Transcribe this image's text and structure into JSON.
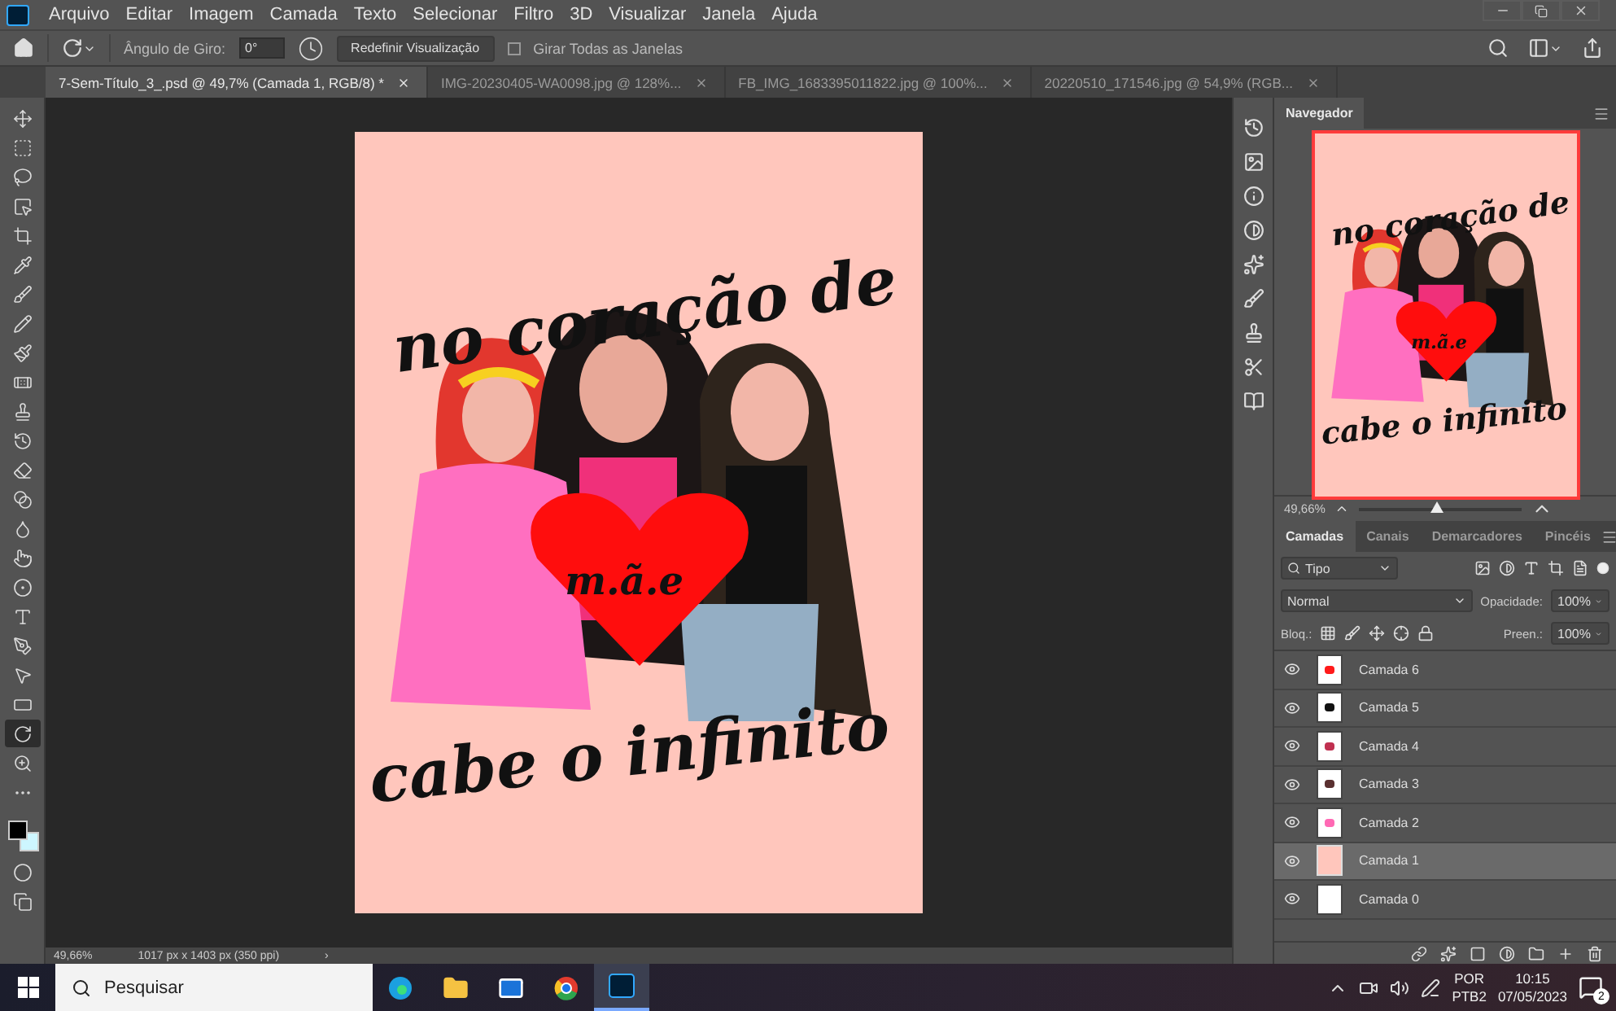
{
  "menu_bar": {
    "items": [
      "Arquivo",
      "Editar",
      "Imagem",
      "Camada",
      "Texto",
      "Selecionar",
      "Filtro",
      "3D",
      "Visualizar",
      "Janela",
      "Ajuda"
    ]
  },
  "options_bar": {
    "angle_label": "Ângulo de Giro:",
    "angle_value": "0°",
    "reset_button": "Redefinir Visualização",
    "rotate_all": {
      "label": "Girar Todas as Janelas",
      "checked": false
    }
  },
  "document_tabs": [
    {
      "label": "7-Sem-Título_3_.psd @ 49,7% (Camada 1, RGB/8) *",
      "selected": true
    },
    {
      "label": "IMG-20230405-WA0098.jpg @ 128%...",
      "selected": false
    },
    {
      "label": "FB_IMG_1683395011822.jpg @ 100%...",
      "selected": false
    },
    {
      "label": "20220510_171546.jpg @ 54,9% (RGB...",
      "selected": false
    }
  ],
  "tools": [
    {
      "selected": false
    },
    {
      "selected": false
    },
    {
      "selected": false
    },
    {
      "selected": false
    },
    {
      "selected": false
    },
    {
      "selected": false
    },
    {
      "selected": false
    },
    {
      "selected": false
    },
    {
      "selected": false
    },
    {
      "selected": false
    },
    {
      "selected": false
    },
    {
      "selected": false
    },
    {
      "selected": false
    },
    {
      "selected": false
    },
    {
      "selected": false
    },
    {
      "selected": false
    },
    {
      "selected": false
    },
    {
      "selected": false
    },
    {
      "selected": false
    },
    {
      "selected": false
    },
    {
      "selected": false
    },
    {
      "selected": true
    },
    {
      "selected": false
    },
    {
      "selected": false
    }
  ],
  "artwork": {
    "top_text": "no coração de",
    "heart_text": "m.ã.e",
    "bottom_text": "cabe o infinito"
  },
  "status_bar": {
    "zoom": "49,66%",
    "document_size": "1017 px x 1403 px (350 ppi)",
    "arrow": "›"
  },
  "navigator": {
    "tab": "Navegador",
    "artwork": {
      "top_text": "no coração de",
      "heart_text": "m.ã.e",
      "bottom_text": "cabe o infinito"
    },
    "zoom": "49,66%",
    "zoom_slider": {
      "level": 0.48
    }
  },
  "layers_panel": {
    "tabs": [
      {
        "label": "Camadas",
        "selected": true
      },
      {
        "label": "Canais",
        "selected": false
      },
      {
        "label": "Demarcadores",
        "selected": false
      },
      {
        "label": "Pincéis",
        "selected": false
      }
    ],
    "filter": "Tipo",
    "blend_mode": "Normal",
    "opacity_label": "Opacidade:",
    "opacity": "100%",
    "lock_label": "Bloq.:",
    "fill_label": "Preen.:",
    "fill": "100%",
    "layers": [
      {
        "name": "Camada 6",
        "visible": true,
        "selected": false,
        "kind": "heart"
      },
      {
        "name": "Camada 5",
        "visible": true,
        "selected": false,
        "kind": "strokes"
      },
      {
        "name": "Camada 4",
        "visible": true,
        "selected": false,
        "kind": "faces"
      },
      {
        "name": "Camada 3",
        "visible": true,
        "selected": false,
        "kind": "figures"
      },
      {
        "name": "Camada 2",
        "visible": true,
        "selected": false,
        "kind": "figure"
      },
      {
        "name": "Camada 1",
        "visible": true,
        "selected": true,
        "kind": "fill"
      },
      {
        "name": "Camada 0",
        "visible": true,
        "selected": false,
        "kind": "sketch"
      }
    ]
  },
  "taskbar": {
    "search_placeholder": "Pesquisar",
    "language": "POR",
    "layout": "PTB2",
    "time": "10:15",
    "date": "07/05/2023",
    "notifications": "2"
  }
}
